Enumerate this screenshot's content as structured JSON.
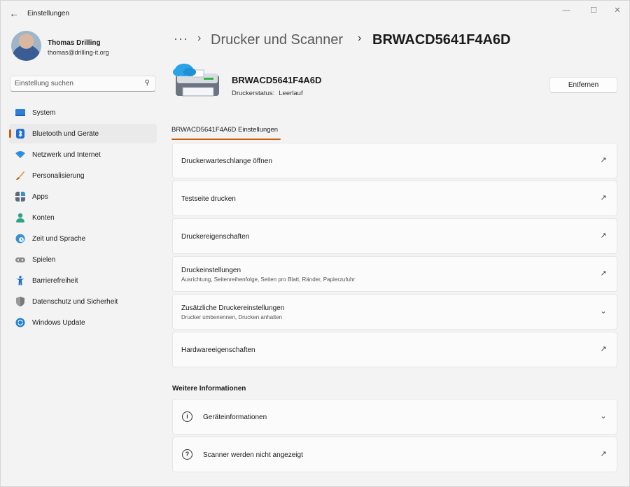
{
  "window": {
    "title": "Einstellungen",
    "controls": {
      "minimize": "—",
      "maximize": "☐",
      "close": "✕"
    }
  },
  "profile": {
    "name": "Thomas Drilling",
    "email": "thomas@drilling-it.org"
  },
  "search": {
    "placeholder": "Einstellung suchen"
  },
  "sidebar": {
    "items": [
      {
        "label": "System",
        "icon": "system-icon",
        "color": "#2f7fd6"
      },
      {
        "label": "Bluetooth und Geräte",
        "icon": "bluetooth-icon",
        "color": "#1e6fd0",
        "active": true
      },
      {
        "label": "Netzwerk und Internet",
        "icon": "wifi-icon",
        "color": "#2a8fe0"
      },
      {
        "label": "Personalisierung",
        "icon": "brush-icon",
        "color": "#e08a2a"
      },
      {
        "label": "Apps",
        "icon": "apps-icon",
        "color": "#5a6a80"
      },
      {
        "label": "Konten",
        "icon": "person-icon",
        "color": "#2aa38a"
      },
      {
        "label": "Zeit und Sprache",
        "icon": "globe-clock-icon",
        "color": "#3a8fd0"
      },
      {
        "label": "Spielen",
        "icon": "gamepad-icon",
        "color": "#8a8a8a"
      },
      {
        "label": "Barrierefreiheit",
        "icon": "accessibility-icon",
        "color": "#1e6fd0"
      },
      {
        "label": "Datenschutz und Sicherheit",
        "icon": "shield-icon",
        "color": "#7a7a7a"
      },
      {
        "label": "Windows Update",
        "icon": "update-icon",
        "color": "#1e7fd6"
      }
    ]
  },
  "breadcrumb": {
    "dots": "···",
    "parent": "Drucker und Scanner",
    "current": "BRWACD5641F4A6D"
  },
  "device": {
    "name": "BRWACD5641F4A6D",
    "status_label": "Druckerstatus:",
    "status_value": "Leerlauf",
    "remove_label": "Entfernen"
  },
  "settings_tab": "BRWACD5641F4A6D Einstellungen",
  "cards": [
    {
      "title": "Druckerwarteschlange öffnen",
      "subtitle": "",
      "action": "external-link-icon"
    },
    {
      "title": "Testseite drucken",
      "subtitle": "",
      "action": "external-link-icon"
    },
    {
      "title": "Druckereigenschaften",
      "subtitle": "",
      "action": "external-link-icon"
    },
    {
      "title": "Druckeinstellungen",
      "subtitle": "Ausrichtung, Seitenreihenfolge, Seiten pro Blatt, Ränder, Papierzufuhr",
      "action": "external-link-icon"
    },
    {
      "title": "Zusätzliche Druckereinstellungen",
      "subtitle": "Drucker umbenennen, Drucken anhalten",
      "action": "chevron-down-icon"
    },
    {
      "title": "Hardwareeigenschaften",
      "subtitle": "",
      "action": "external-link-icon"
    }
  ],
  "more_info": {
    "heading": "Weitere Informationen",
    "items": [
      {
        "title": "Geräteinformationen",
        "icon": "info-icon",
        "action": "chevron-down-icon"
      },
      {
        "title": "Scanner werden nicht angezeigt",
        "icon": "help-icon",
        "action": "external-link-icon"
      }
    ]
  },
  "colors": {
    "accent": "#c95f0a",
    "background": "#f3f3f3",
    "card": "#fbfbfb"
  }
}
